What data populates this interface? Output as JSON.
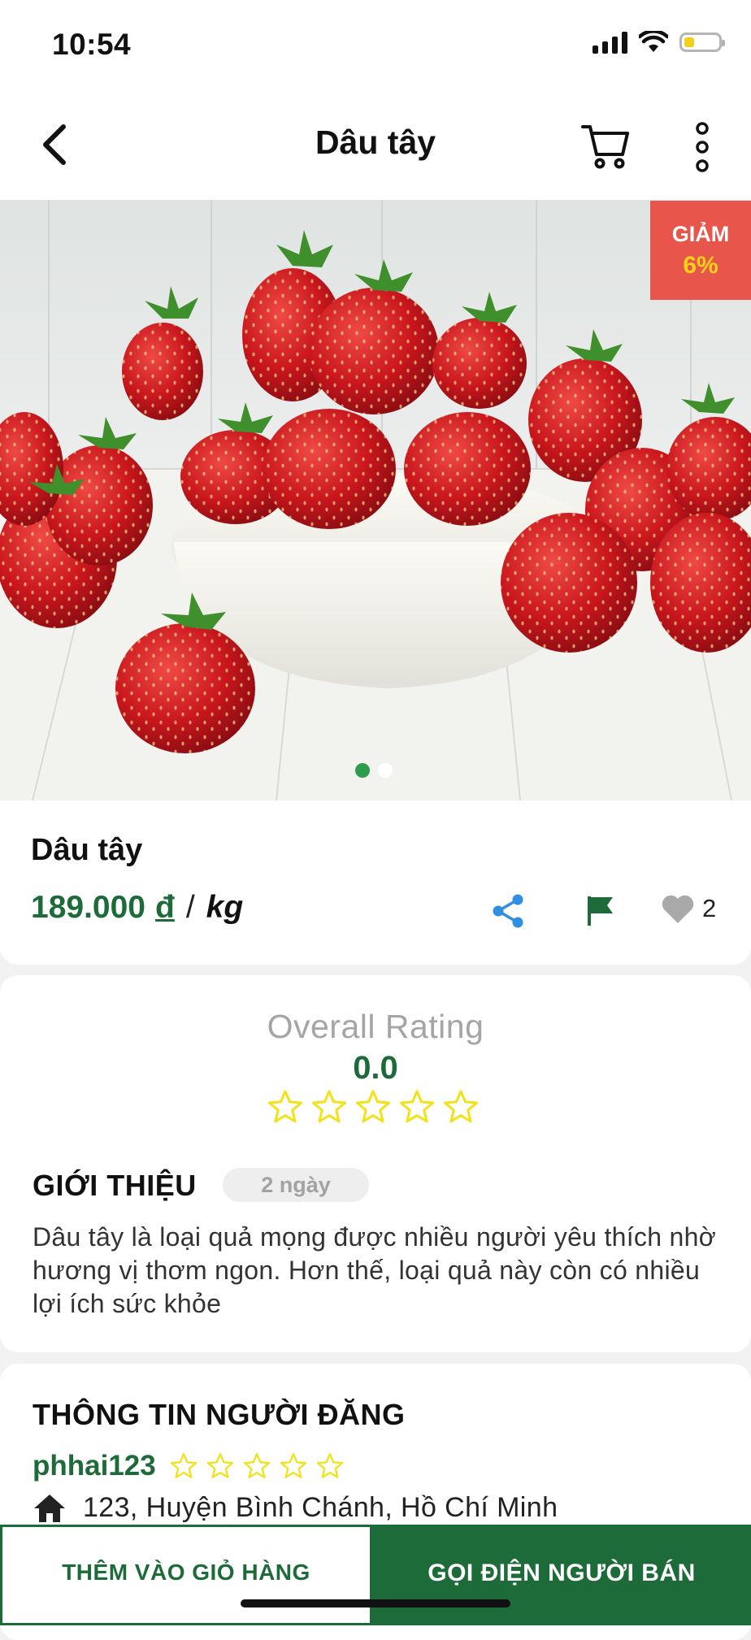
{
  "status_bar": {
    "time": "10:54"
  },
  "header": {
    "title": "Dâu tây"
  },
  "hero": {
    "discount_label": "GIẢM",
    "discount_value": "6%",
    "slide_count": 2,
    "active_slide": 1
  },
  "product": {
    "name": "Dâu tây",
    "price": "189.000",
    "currency": "đ",
    "separator": "/",
    "unit": "kg",
    "like_count": "2"
  },
  "rating": {
    "label": "Overall Rating",
    "value": "0.0",
    "stars": 0,
    "max_stars": 5
  },
  "intro": {
    "title": "GIỚI THIỆU",
    "age": "2 ngày",
    "text": "Dâu tây là loại quả mọng được nhiều người yêu thích nhờ hương vị thơm ngon. Hơn thế, loại quả này còn có nhiều lợi ích sức khỏe"
  },
  "seller": {
    "title": "THÔNG TIN NGƯỜI ĐĂNG",
    "name": "phhai123",
    "stars": 0,
    "max_stars": 5,
    "address": "123, Huyện Bình Chánh, Hồ Chí Minh"
  },
  "actions": {
    "add_to_cart": "THÊM VÀO GIỎ HÀNG",
    "call_seller": "GỌI ĐIỆN NGƯỜI BÁN"
  },
  "colors": {
    "primary": "#1e6b3a",
    "discount": "#e8554a",
    "discount_text": "#ffd21a",
    "star": "#f2e21c",
    "share": "#2f8fe0"
  }
}
